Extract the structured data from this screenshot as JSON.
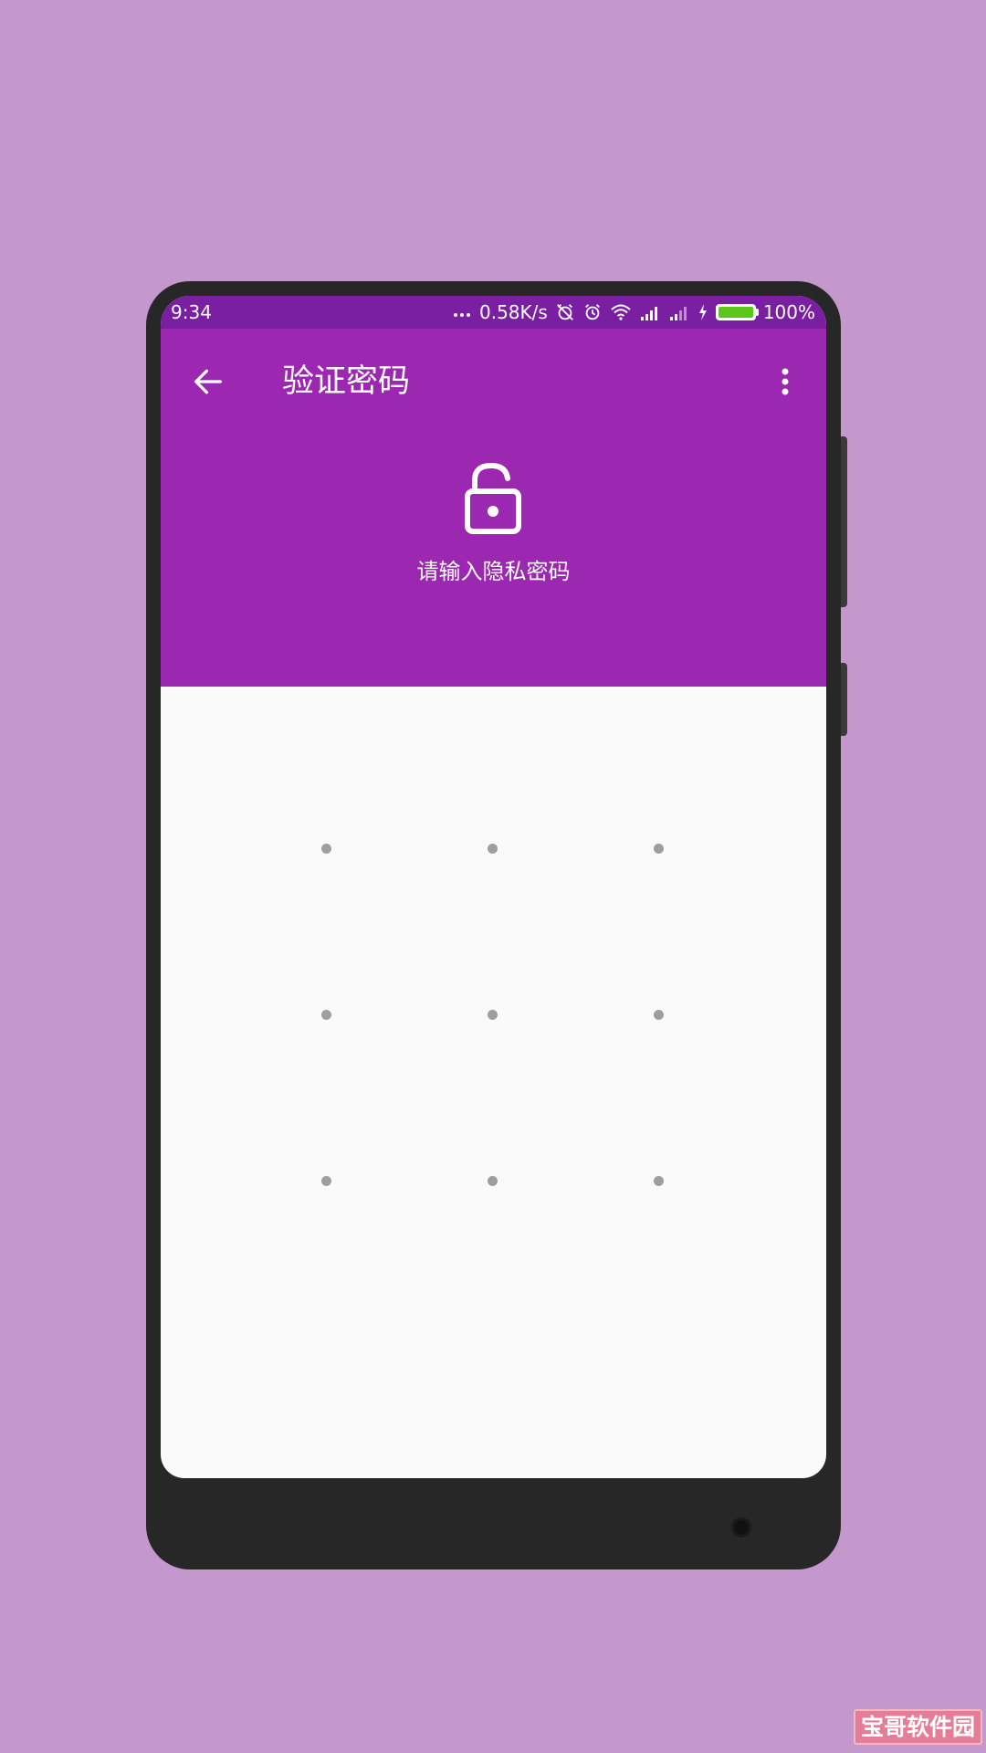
{
  "status_bar": {
    "time": "9:34",
    "network_speed": "0.58K/s",
    "battery_percent": "100%",
    "battery_level": 1.0,
    "icons": [
      "more-dots-icon",
      "alarm-off-icon",
      "alarm-icon",
      "wifi-icon",
      "signal-icon",
      "signal-icon-2",
      "charging-icon",
      "battery-icon"
    ]
  },
  "toolbar": {
    "title": "验证密码",
    "back_icon": "arrow-back-icon",
    "more_icon": "more-vert-icon"
  },
  "lock": {
    "icon": "lock-open-icon",
    "prompt": "请输入隐私密码"
  },
  "pattern": {
    "rows": 3,
    "cols": 3
  },
  "watermark": {
    "text": "宝哥软件园"
  },
  "colors": {
    "background": "#c598cd",
    "status_bar": "#7b1fa2",
    "header": "#9c27b0",
    "screen": "#fafafa",
    "pattern_dot": "#9e9e9e",
    "battery_fill": "#5cc61b"
  }
}
